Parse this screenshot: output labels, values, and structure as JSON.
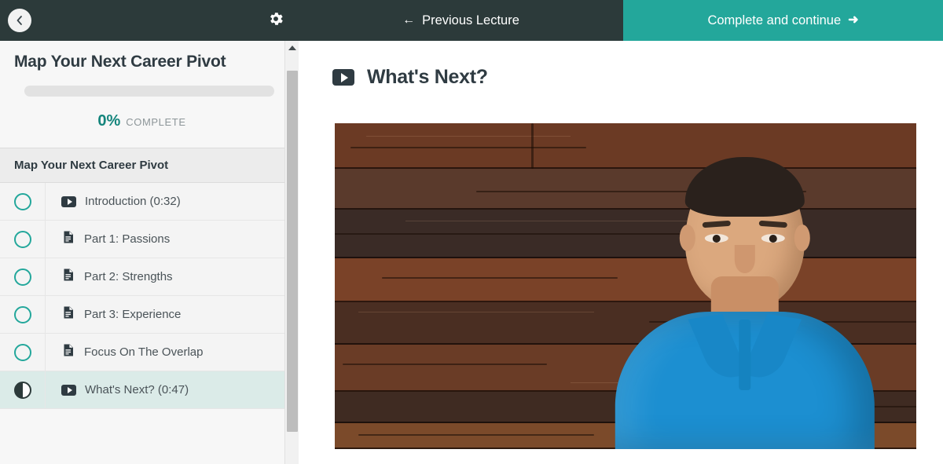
{
  "topbar": {
    "back_icon": "chevron-left-icon",
    "settings_icon": "gear-icon",
    "previous_label": "Previous Lecture",
    "previous_arrow": "←",
    "next_label": "Complete and continue",
    "next_arrow": "➜",
    "accent_color": "#23a79b",
    "bar_color": "#2c3a3a"
  },
  "sidebar": {
    "course_title": "Map Your Next Career Pivot",
    "progress_percent": "0%",
    "progress_word": "COMPLETE",
    "progress_value": 0,
    "section_title": "Map Your Next Career Pivot",
    "lectures": [
      {
        "label": "Introduction (0:32)",
        "icon": "video-icon",
        "status": "incomplete",
        "active": false
      },
      {
        "label": "Part 1: Passions",
        "icon": "document-icon",
        "status": "incomplete",
        "active": false
      },
      {
        "label": "Part 2: Strengths",
        "icon": "document-icon",
        "status": "incomplete",
        "active": false
      },
      {
        "label": "Part 3: Experience",
        "icon": "document-icon",
        "status": "incomplete",
        "active": false
      },
      {
        "label": "Focus On The Overlap",
        "icon": "document-icon",
        "status": "incomplete",
        "active": false
      },
      {
        "label": "What's Next? (0:47)",
        "icon": "video-icon",
        "status": "in-progress",
        "active": true
      }
    ]
  },
  "main": {
    "lecture_icon": "video-icon",
    "lecture_title": "What's Next?",
    "video": {
      "description": "Man in blue polo shirt speaking in front of a rustic dark wood plank wall",
      "shirt_color": "#1c8fd1",
      "background_color": "#4a2a1c"
    }
  },
  "scrollbar": {
    "up_arrow_icon": "scroll-up-arrow-icon",
    "thumb_name": "scrollbar-thumb"
  }
}
